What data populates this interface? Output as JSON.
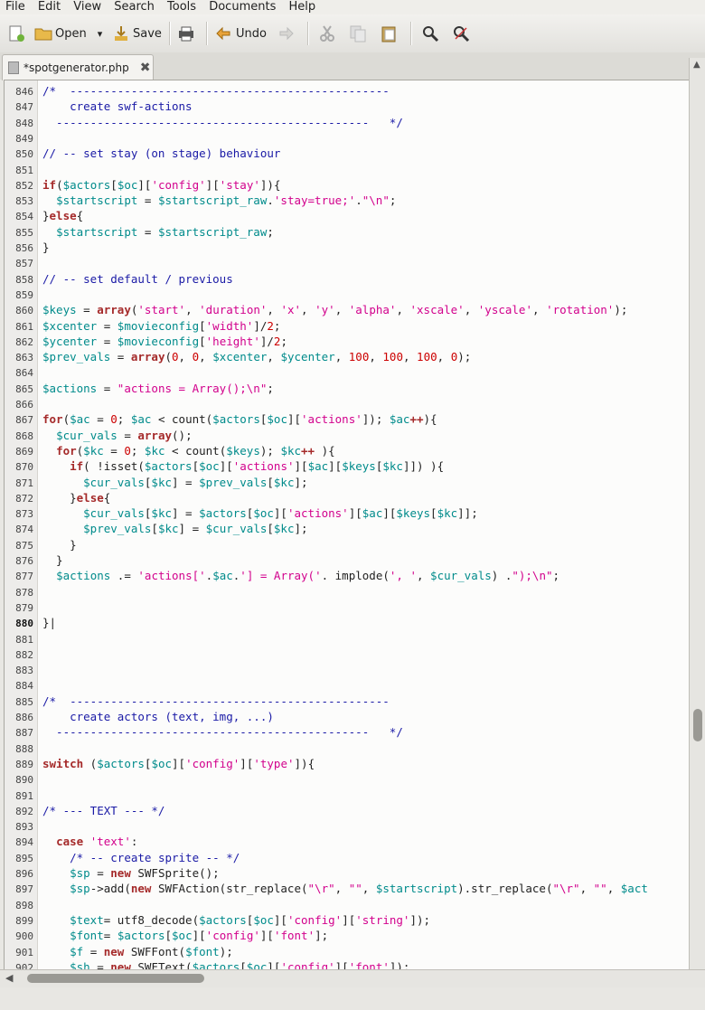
{
  "menu": {
    "items": [
      "File",
      "Edit",
      "View",
      "Search",
      "Tools",
      "Documents",
      "Help"
    ]
  },
  "toolbar": {
    "open_label": "Open",
    "save_label": "Save",
    "undo_label": "Undo"
  },
  "tab": {
    "title": "*spotgenerator.php",
    "close": "✖"
  },
  "editor": {
    "current_line": 880,
    "lines": [
      {
        "n": 846,
        "html": "<span class=\"c\">/*  -----------------------------------------------</span>"
      },
      {
        "n": 847,
        "html": "<span class=\"c\">    create swf-actions</span>"
      },
      {
        "n": 848,
        "html": "<span class=\"c\">  ----------------------------------------------   */</span>"
      },
      {
        "n": 849,
        "html": ""
      },
      {
        "n": 850,
        "html": "<span class=\"c\">// -- set stay (on stage) behaviour</span>"
      },
      {
        "n": 851,
        "html": ""
      },
      {
        "n": 852,
        "html": "<span class=\"k\">if</span>(<span class=\"v\">$actors</span>[<span class=\"v\">$oc</span>][<span class=\"s\">'config'</span>][<span class=\"s\">'stay'</span>]){"
      },
      {
        "n": 853,
        "html": "  <span class=\"v\">$startscript</span> = <span class=\"v\">$startscript_raw</span>.<span class=\"s\">'stay=true;'</span>.<span class=\"s\">\"\\n\"</span>;"
      },
      {
        "n": 854,
        "html": "}<span class=\"k\">else</span>{"
      },
      {
        "n": 855,
        "html": "  <span class=\"v\">$startscript</span> = <span class=\"v\">$startscript_raw</span>;"
      },
      {
        "n": 856,
        "html": "}"
      },
      {
        "n": 857,
        "html": ""
      },
      {
        "n": 858,
        "html": "<span class=\"c\">// -- set default / previous</span>"
      },
      {
        "n": 859,
        "html": ""
      },
      {
        "n": 860,
        "html": "<span class=\"v\">$keys</span> = <span class=\"k\">array</span>(<span class=\"s\">'start'</span>, <span class=\"s\">'duration'</span>, <span class=\"s\">'x'</span>, <span class=\"s\">'y'</span>, <span class=\"s\">'alpha'</span>, <span class=\"s\">'xscale'</span>, <span class=\"s\">'yscale'</span>, <span class=\"s\">'rotation'</span>);"
      },
      {
        "n": 861,
        "html": "<span class=\"v\">$xcenter</span> = <span class=\"v\">$movieconfig</span>[<span class=\"s\">'width'</span>]/<span class=\"n\">2</span>;"
      },
      {
        "n": 862,
        "html": "<span class=\"v\">$ycenter</span> = <span class=\"v\">$movieconfig</span>[<span class=\"s\">'height'</span>]/<span class=\"n\">2</span>;"
      },
      {
        "n": 863,
        "html": "<span class=\"v\">$prev_vals</span> = <span class=\"k\">array</span>(<span class=\"n\">0</span>, <span class=\"n\">0</span>, <span class=\"v\">$xcenter</span>, <span class=\"v\">$ycenter</span>, <span class=\"n\">100</span>, <span class=\"n\">100</span>, <span class=\"n\">100</span>, <span class=\"n\">0</span>);"
      },
      {
        "n": 864,
        "html": ""
      },
      {
        "n": 865,
        "html": "<span class=\"v\">$actions</span> = <span class=\"s\">\"actions = Array();\\n\"</span>;"
      },
      {
        "n": 866,
        "html": ""
      },
      {
        "n": 867,
        "html": "<span class=\"k\">for</span>(<span class=\"v\">$ac</span> = <span class=\"n\">0</span>; <span class=\"v\">$ac</span> &lt; count(<span class=\"v\">$actors</span>[<span class=\"v\">$oc</span>][<span class=\"s\">'actions'</span>]); <span class=\"v\">$ac</span><span class=\"k\">++</span>){"
      },
      {
        "n": 868,
        "html": "  <span class=\"v\">$cur_vals</span> = <span class=\"k\">array</span>();"
      },
      {
        "n": 869,
        "html": "  <span class=\"k\">for</span>(<span class=\"v\">$kc</span> = <span class=\"n\">0</span>; <span class=\"v\">$kc</span> &lt; count(<span class=\"v\">$keys</span>); <span class=\"v\">$kc</span><span class=\"k\">++</span> ){"
      },
      {
        "n": 870,
        "html": "    <span class=\"k\">if</span>( !isset(<span class=\"v\">$actors</span>[<span class=\"v\">$oc</span>][<span class=\"s\">'actions'</span>][<span class=\"v\">$ac</span>][<span class=\"v\">$keys</span>[<span class=\"v\">$kc</span>]]) ){"
      },
      {
        "n": 871,
        "html": "      <span class=\"v\">$cur_vals</span>[<span class=\"v\">$kc</span>] = <span class=\"v\">$prev_vals</span>[<span class=\"v\">$kc</span>];"
      },
      {
        "n": 872,
        "html": "    }<span class=\"k\">else</span>{"
      },
      {
        "n": 873,
        "html": "      <span class=\"v\">$cur_vals</span>[<span class=\"v\">$kc</span>] = <span class=\"v\">$actors</span>[<span class=\"v\">$oc</span>][<span class=\"s\">'actions'</span>][<span class=\"v\">$ac</span>][<span class=\"v\">$keys</span>[<span class=\"v\">$kc</span>]];"
      },
      {
        "n": 874,
        "html": "      <span class=\"v\">$prev_vals</span>[<span class=\"v\">$kc</span>] = <span class=\"v\">$cur_vals</span>[<span class=\"v\">$kc</span>];"
      },
      {
        "n": 875,
        "html": "    }"
      },
      {
        "n": 876,
        "html": "  }"
      },
      {
        "n": 877,
        "html": "  <span class=\"v\">$actions</span> .= <span class=\"s\">'actions['</span>.<span class=\"v\">$ac</span>.<span class=\"s\">'] = Array('</span>. implode(<span class=\"s\">', '</span>, <span class=\"v\">$cur_vals</span>) .<span class=\"s\">\");\\n\"</span>;"
      },
      {
        "n": 878,
        "html": ""
      },
      {
        "n": 879,
        "html": ""
      },
      {
        "n": 880,
        "html": "}|"
      },
      {
        "n": 881,
        "html": ""
      },
      {
        "n": 882,
        "html": ""
      },
      {
        "n": 883,
        "html": ""
      },
      {
        "n": 884,
        "html": ""
      },
      {
        "n": 885,
        "html": "<span class=\"c\">/*  -----------------------------------------------</span>"
      },
      {
        "n": 886,
        "html": "<span class=\"c\">    create actors (text, img, ...)</span>"
      },
      {
        "n": 887,
        "html": "<span class=\"c\">  ----------------------------------------------   */</span>"
      },
      {
        "n": 888,
        "html": ""
      },
      {
        "n": 889,
        "html": "<span class=\"k\">switch</span> (<span class=\"v\">$actors</span>[<span class=\"v\">$oc</span>][<span class=\"s\">'config'</span>][<span class=\"s\">'type'</span>]){"
      },
      {
        "n": 890,
        "html": ""
      },
      {
        "n": 891,
        "html": ""
      },
      {
        "n": 892,
        "html": "<span class=\"c\">/* --- TEXT --- */</span>"
      },
      {
        "n": 893,
        "html": ""
      },
      {
        "n": 894,
        "html": "  <span class=\"k\">case</span> <span class=\"s\">'text'</span>:"
      },
      {
        "n": 895,
        "html": "    <span class=\"c\">/* -- create sprite -- */</span>"
      },
      {
        "n": 896,
        "html": "    <span class=\"v\">$sp</span> = <span class=\"k\">new</span> SWFSprite();"
      },
      {
        "n": 897,
        "html": "    <span class=\"v\">$sp</span>-&gt;add(<span class=\"k\">new</span> SWFAction(str_replace(<span class=\"s\">\"\\r\"</span>, <span class=\"s\">\"\"</span>, <span class=\"v\">$startscript</span>).str_replace(<span class=\"s\">\"\\r\"</span>, <span class=\"s\">\"\"</span>, <span class=\"v\">$act</span>"
      },
      {
        "n": 898,
        "html": ""
      },
      {
        "n": 899,
        "html": "    <span class=\"v\">$text</span>= utf8_decode(<span class=\"v\">$actors</span>[<span class=\"v\">$oc</span>][<span class=\"s\">'config'</span>][<span class=\"s\">'string'</span>]);"
      },
      {
        "n": 900,
        "html": "    <span class=\"v\">$font</span>= <span class=\"v\">$actors</span>[<span class=\"v\">$oc</span>][<span class=\"s\">'config'</span>][<span class=\"s\">'font'</span>];"
      },
      {
        "n": 901,
        "html": "    <span class=\"v\">$f</span> = <span class=\"k\">new</span> SWFFont(<span class=\"v\">$font</span>);"
      },
      {
        "n": 902,
        "html": "    <span class=\"v\">$sh</span> = <span class=\"k\">new</span> SWFText(<span class=\"v\">$actors</span>[<span class=\"v\">$oc</span>][<span class=\"s\">'config'</span>][<span class=\"s\">'font'</span>]);"
      }
    ]
  }
}
